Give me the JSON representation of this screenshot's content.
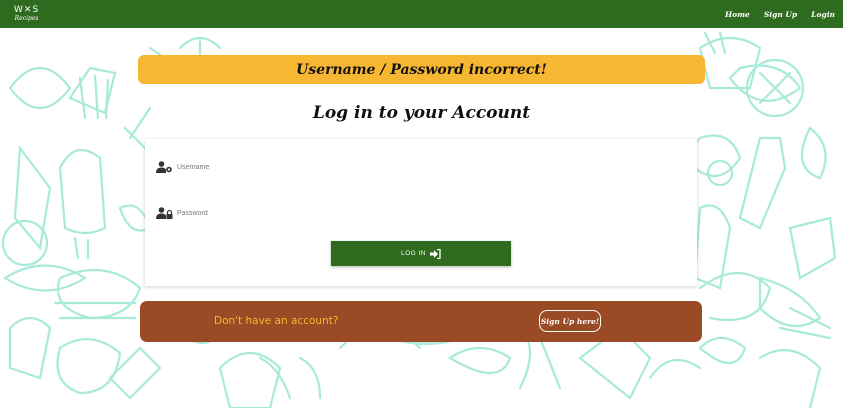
{
  "navbar": {
    "brand_icons": "W✕S",
    "brand_text": "Recipes",
    "links": [
      {
        "label": "Home"
      },
      {
        "label": "Sign Up"
      },
      {
        "label": "Login"
      }
    ],
    "color": "#2f6b1f"
  },
  "alert": {
    "message": "Username / Password incorrect!",
    "color": "#f7b733"
  },
  "page_title": "Log in to your Account",
  "login_form": {
    "username_placeholder": "Username",
    "username_icon": "user-gear-icon",
    "password_placeholder": "Password",
    "password_icon": "user-lock-icon",
    "submit_label": "LOG IN",
    "submit_icon": "sign-in-icon"
  },
  "signup": {
    "prompt": "Don't have an account?",
    "button_label": "Sign Up here!",
    "bar_color": "#9a4a25",
    "prompt_color": "#f7b733"
  }
}
